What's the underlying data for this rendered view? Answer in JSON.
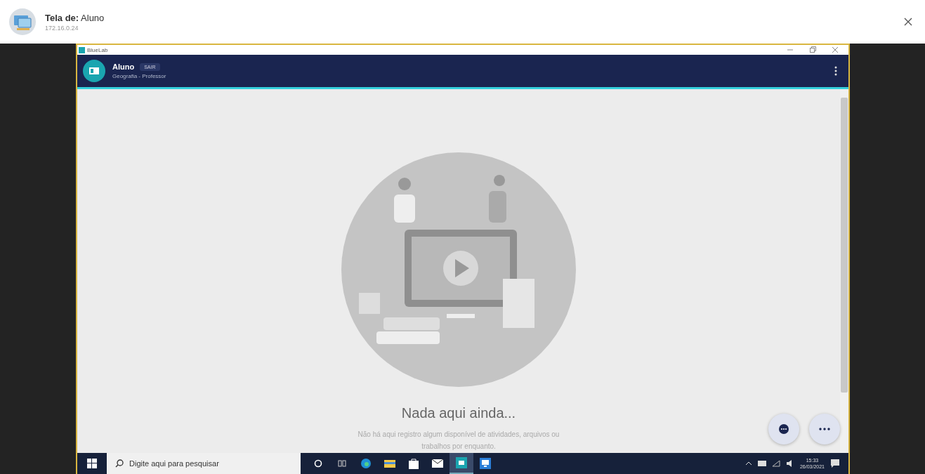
{
  "header": {
    "title_label": "Tela de:",
    "title_name": "Aluno",
    "address": "172.16.0.24"
  },
  "remote_window": {
    "title": "BlueLab"
  },
  "app_bar": {
    "name": "Aluno",
    "badge": "SAIR",
    "subtitle": "Geografia - Professor"
  },
  "empty_state": {
    "title": "Nada aqui ainda...",
    "description": "Não há aqui registro algum disponível de atividades, arquivos ou trabalhos por enquanto."
  },
  "taskbar": {
    "search_placeholder": "Digite aqui para pesquisar",
    "apps": [
      {
        "kind": "cortana",
        "active": false
      },
      {
        "kind": "taskview",
        "active": false
      },
      {
        "kind": "edge",
        "active": false
      },
      {
        "kind": "folder",
        "active": false
      },
      {
        "kind": "store",
        "active": false
      },
      {
        "kind": "mail",
        "active": false
      },
      {
        "kind": "bluelab",
        "active": true
      },
      {
        "kind": "remote",
        "active": false
      }
    ],
    "time": "15:33",
    "date": "26/03/2021"
  }
}
